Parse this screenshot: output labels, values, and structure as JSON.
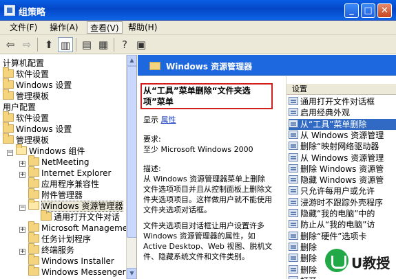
{
  "window": {
    "title": "组策略"
  },
  "menubar": [
    {
      "label": "文件(F)"
    },
    {
      "label": "操作(A)"
    },
    {
      "label": "查看(V)"
    },
    {
      "label": "帮助(H)"
    }
  ],
  "tree": [
    {
      "label": "计算机配置",
      "level": 0,
      "folder": false,
      "expander": ""
    },
    {
      "label": "软件设置",
      "level": 1,
      "folder": true,
      "expander": ""
    },
    {
      "label": "Windows 设置",
      "level": 1,
      "folder": true,
      "expander": ""
    },
    {
      "label": "管理模板",
      "level": 1,
      "folder": true,
      "expander": ""
    },
    {
      "label": "用户配置",
      "level": 0,
      "folder": false,
      "expander": ""
    },
    {
      "label": "软件设置",
      "level": 1,
      "folder": true,
      "expander": ""
    },
    {
      "label": "Windows 设置",
      "level": 1,
      "folder": true,
      "expander": ""
    },
    {
      "label": "管理模板",
      "level": 1,
      "folder": true,
      "expander": ""
    },
    {
      "label": "Windows 组件",
      "level": 2,
      "folder": true,
      "expander": "−"
    },
    {
      "label": "NetMeeting",
      "level": 3,
      "folder": true,
      "expander": "+"
    },
    {
      "label": "Internet Explorer",
      "level": 3,
      "folder": true,
      "expander": "+"
    },
    {
      "label": "应用程序兼容性",
      "level": 3,
      "folder": true,
      "expander": ""
    },
    {
      "label": "附件管理器",
      "level": 3,
      "folder": true,
      "expander": ""
    },
    {
      "label": "Windows 资源管理器",
      "level": 3,
      "folder": true,
      "expander": "−",
      "selected": true
    },
    {
      "label": "通用打开文件对话",
      "level": 4,
      "folder": true,
      "expander": ""
    },
    {
      "label": "Microsoft Managemen",
      "level": 3,
      "folder": true,
      "expander": "+"
    },
    {
      "label": "任务计划程序",
      "level": 3,
      "folder": true,
      "expander": ""
    },
    {
      "label": "终端服务",
      "level": 3,
      "folder": true,
      "expander": "+"
    },
    {
      "label": "Windows Installer",
      "level": 3,
      "folder": true,
      "expander": ""
    },
    {
      "label": "Windows Messenger",
      "level": 3,
      "folder": true,
      "expander": ""
    }
  ],
  "right": {
    "header_title": "Windows 资源管理器",
    "policy_title": "从“工具”菜单删除“文件夹选项”菜单",
    "show_label": "显示",
    "properties_link": "属性",
    "req_label": "要求:",
    "req_value": "至少 Microsoft Windows 2000",
    "desc_label": "描述:",
    "desc_text": "从 Windows 资源管理器菜单上删除文件选项项目并且从控制面板上删除文件夹选项项目。这样做用户就不能使用文件夹选项对话框。",
    "desc_text2": "文件夹选项目对话框让用户设置许多 Windows 资源管理器的属性，如 Active Desktop、Web 视图、脱机文件、隐藏系统文件和文件类别。"
  },
  "list": {
    "column": "设置",
    "items": [
      {
        "label": "通用打开文件对话框",
        "selected": false
      },
      {
        "label": "启用经典外观",
        "selected": false
      },
      {
        "label": "从“工具”菜单删除",
        "selected": true
      },
      {
        "label": "从 Windows 资源管理",
        "selected": false
      },
      {
        "label": "删除“映射网络驱动器",
        "selected": false
      },
      {
        "label": "从 Windows 资源管理",
        "selected": false
      },
      {
        "label": "删除 Windows 资源管",
        "selected": false
      },
      {
        "label": "隐藏 Windows 资源管",
        "selected": false
      },
      {
        "label": "只允许每用户或允许",
        "selected": false
      },
      {
        "label": "浸游时不跟踪外壳程序",
        "selected": false
      },
      {
        "label": "隐藏“我的电脑”中的",
        "selected": false
      },
      {
        "label": "防止从“我的电脑”访",
        "selected": false
      },
      {
        "label": "删除“硬件”选项卡",
        "selected": false
      },
      {
        "label": "删除",
        "selected": false
      },
      {
        "label": "删除",
        "selected": false
      },
      {
        "label": "删除",
        "selected": false
      },
      {
        "label": "打开",
        "selected": false
      }
    ]
  },
  "watermark": {
    "text": "U教授"
  }
}
